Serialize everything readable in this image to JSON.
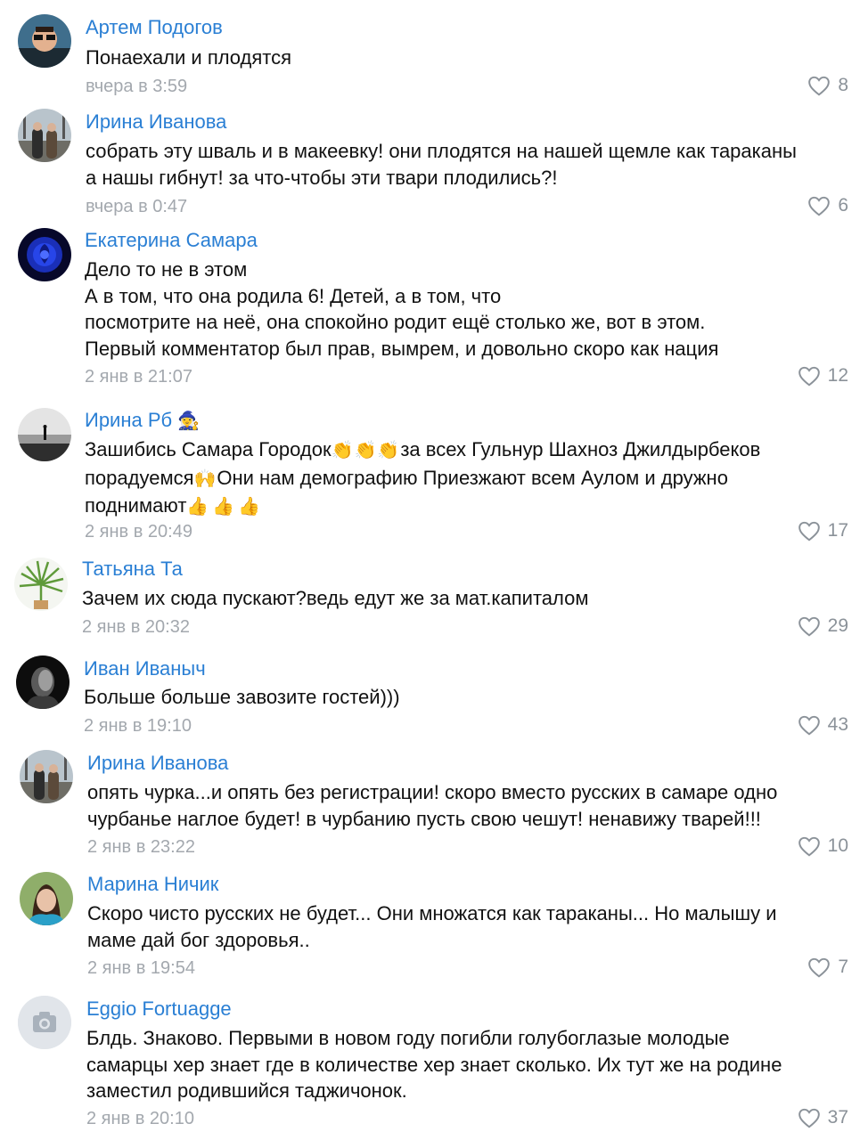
{
  "comments": [
    {
      "author": "Артем Подогов",
      "lines": [
        "Понаехали и плодятся"
      ],
      "time": "вчера в 3:59",
      "likes": "8"
    },
    {
      "author": "Ирина Иванова",
      "lines": [
        "собрать эту шваль и в макеевку! они плодятся на нашей щемле как тараканы",
        "а нашы гибнут! за что-чтобы эти твари плодились?!"
      ],
      "time": "вчера в 0:47",
      "likes": "6"
    },
    {
      "author": "Екатерина Самара",
      "lines": [
        "Дело то не в этом",
        "А в том, что она родила 6! Детей, а в том, что",
        "посмотрите на неё, она спокойно родит ещё столько же, вот в этом.",
        "Первый комментатор был прав, вымрем, и довольно скоро как нация"
      ],
      "time": "2 янв в 21:07",
      "likes": "12"
    },
    {
      "author": "Ирина Рб",
      "name_emoji": "🧙‍♀️",
      "line1_a": "Зашибись Самара Городок",
      "line1_emoji": "👏👏👏",
      "line1_b": "за всех Гульнур Шахноз Джилдырбеков",
      "line2_a": "порадуемся",
      "line2_emoji": "🙌",
      "line2_b": "Они нам демографию Приезжают всем Аулом и дружно",
      "line3_a": "поднимают",
      "line3_emoji": "👍👍👍",
      "time": "2 янв в 20:49",
      "likes": "17"
    },
    {
      "author": "Татьяна Та",
      "lines": [
        "Зачем их сюда пускают?ведь едут же за мат.капиталом"
      ],
      "time": "2 янв в 20:32",
      "likes": "29"
    },
    {
      "author": "Иван Иваныч",
      "lines": [
        "Больше больше завозите гостей)))"
      ],
      "time": "2 янв в 19:10",
      "likes": "43"
    },
    {
      "author": "Ирина Иванова",
      "lines": [
        "опять чурка...и опять без регистрации! скоро вместо русских в самаре одно",
        "чурбанье наглое будет! в чурбанию пусть свою чешут! ненавижу тварей!!!"
      ],
      "time": "2 янв в 23:22",
      "likes": "10"
    },
    {
      "author": "Марина Ничик",
      "lines": [
        "Скоро чисто русских не будет... Они множатся как тараканы... Но малышу и",
        "маме дай бог здоровья.."
      ],
      "time": "2 янв в 19:54",
      "likes": "7"
    },
    {
      "author": "Eggio Fortuagge",
      "lines": [
        "Блдь. Знаково. Первыми в новом году погибли голубоглазые молодые",
        "самарцы хер знает где в количестве хер знает сколько. Их тут же на родине",
        "заместил родившийся таджичонок."
      ],
      "time": "2 янв в 20:10",
      "likes": "37"
    }
  ],
  "colors": {
    "author": "#2a7fd4",
    "text": "#111111",
    "time": "#a3a8ae",
    "like": "#8b9299"
  },
  "icons": {
    "like": "heart-icon",
    "no_photo": "camera-icon"
  }
}
